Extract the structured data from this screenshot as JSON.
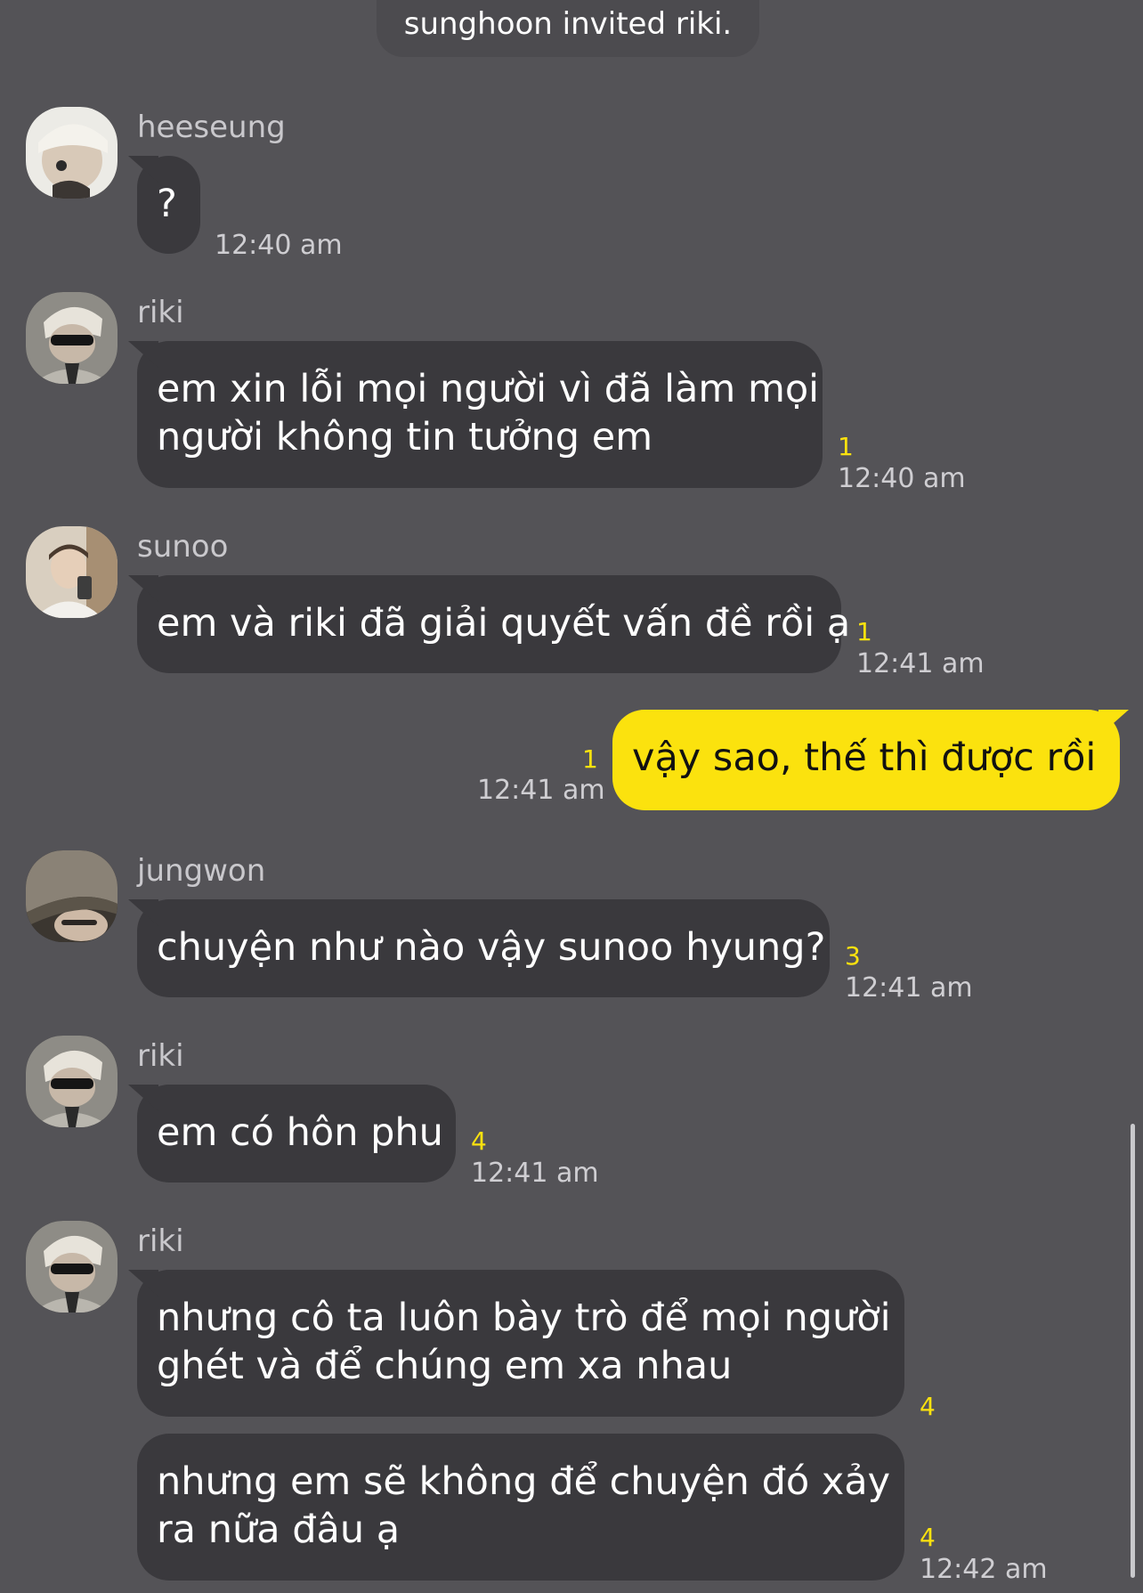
{
  "system_message": "sunghoon invited riki.",
  "messages": [
    {
      "sender": "heeseung",
      "text": "?",
      "unread": "",
      "time": "12:40 am"
    },
    {
      "sender": "riki",
      "lines": [
        "em xin lỗi mọi người vì đã làm mọi",
        "người không tin tưởng em"
      ],
      "unread": "1",
      "time": "12:40 am"
    },
    {
      "sender": "sunoo",
      "text": "em và riki đã giải quyết vấn đề rồi ạ",
      "unread": "1",
      "time": "12:41 am"
    },
    {
      "sender": "me",
      "text": "vậy sao, thế thì được rồi",
      "unread": "1",
      "time": "12:41 am"
    },
    {
      "sender": "jungwon",
      "text": "chuyện như nào vậy sunoo hyung?",
      "unread": "3",
      "time": "12:41 am"
    },
    {
      "sender": "riki",
      "text": "em có hôn phu",
      "unread": "4",
      "time": "12:41 am"
    },
    {
      "sender": "riki",
      "lines": [
        "nhưng cô ta luôn bày trò để mọi người",
        "ghét và để chúng em xa nhau"
      ],
      "unread": "4",
      "time": ""
    },
    {
      "sender": "riki",
      "lines": [
        "nhưng em sẽ không để chuyện đó xảy",
        "ra nữa đâu ạ"
      ],
      "unread": "4",
      "time": "12:42 am"
    }
  ],
  "colors": {
    "background": "#545357",
    "bubble_other": "#3a393d",
    "bubble_mine": "#fbe20e",
    "unread": "#fbe20e"
  }
}
